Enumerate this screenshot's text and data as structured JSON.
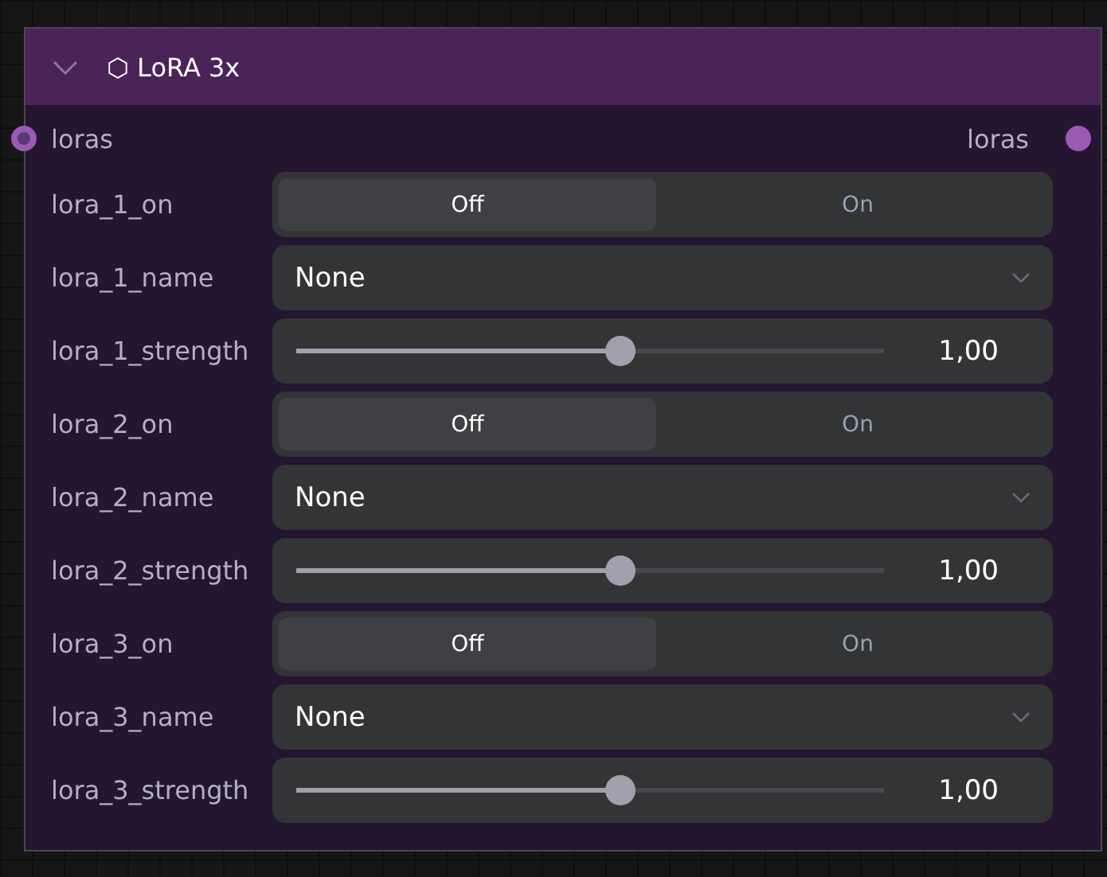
{
  "node": {
    "title": "⬡ LoRA 3x",
    "inputs": [
      {
        "label": "loras"
      }
    ],
    "outputs": [
      {
        "label": "loras"
      }
    ],
    "widgets": [
      {
        "kind": "toggle",
        "label": "lora_1_on",
        "options": [
          {
            "label": "Off",
            "selected": true
          },
          {
            "label": "On",
            "selected": false
          }
        ]
      },
      {
        "kind": "combo",
        "label": "lora_1_name",
        "value": "None"
      },
      {
        "kind": "slider",
        "label": "lora_1_strength",
        "level": 0.55,
        "value": "1,00"
      },
      {
        "kind": "toggle",
        "label": "lora_2_on",
        "options": [
          {
            "label": "Off",
            "selected": true
          },
          {
            "label": "On",
            "selected": false
          }
        ]
      },
      {
        "kind": "combo",
        "label": "lora_2_name",
        "value": "None"
      },
      {
        "kind": "slider",
        "label": "lora_2_strength",
        "level": 0.55,
        "value": "1,00"
      },
      {
        "kind": "toggle",
        "label": "lora_3_on",
        "options": [
          {
            "label": "Off",
            "selected": true
          },
          {
            "label": "On",
            "selected": false
          }
        ]
      },
      {
        "kind": "combo",
        "label": "lora_3_name",
        "value": "None"
      },
      {
        "kind": "slider",
        "label": "lora_3_strength",
        "level": 0.55,
        "value": "1,00"
      }
    ]
  }
}
